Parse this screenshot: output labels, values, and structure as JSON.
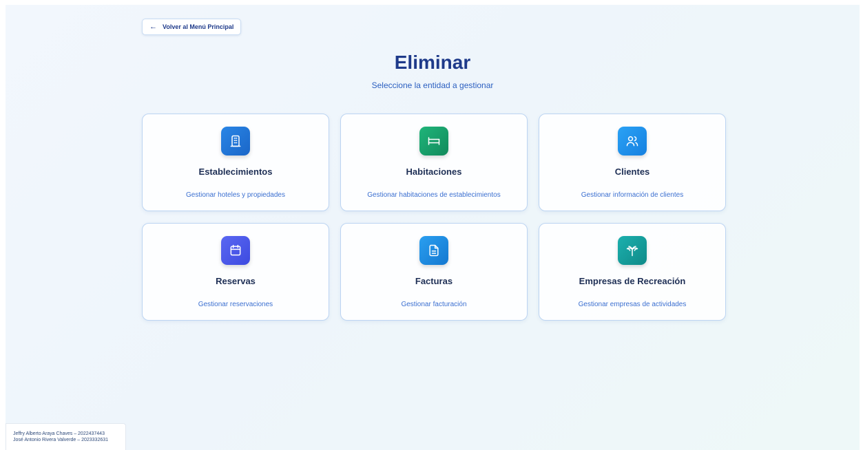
{
  "back_button": {
    "arrow": "←",
    "label": "Volver al Menú Principal"
  },
  "header": {
    "title": "Eliminar",
    "subtitle": "Seleccione la entidad a gestionar"
  },
  "cards": [
    {
      "title": "Establecimientos",
      "description": "Gestionar hoteles y propiedades",
      "icon": "building-icon",
      "color": "#1f78d8"
    },
    {
      "title": "Habitaciones",
      "description": "Gestionar habitaciones de establecimientos",
      "icon": "bed-icon",
      "color": "#16a06a"
    },
    {
      "title": "Clientes",
      "description": "Gestionar información de clientes",
      "icon": "users-icon",
      "color": "#1e90f0"
    },
    {
      "title": "Reservas",
      "description": "Gestionar reservaciones",
      "icon": "calendar-icon",
      "color": "#4a58ee"
    },
    {
      "title": "Facturas",
      "description": "Gestionar facturación",
      "icon": "file-text-icon",
      "color": "#1a8fe0"
    },
    {
      "title": "Empresas de Recreación",
      "description": "Gestionar empresas de actividades",
      "icon": "palm-tree-icon",
      "color": "#14a0a0"
    }
  ],
  "footer": {
    "line1": "Jeffry Alberto Araya Chaves – 2022437443",
    "line2": "José Antonio Rivera Valverde – 2023332631"
  }
}
